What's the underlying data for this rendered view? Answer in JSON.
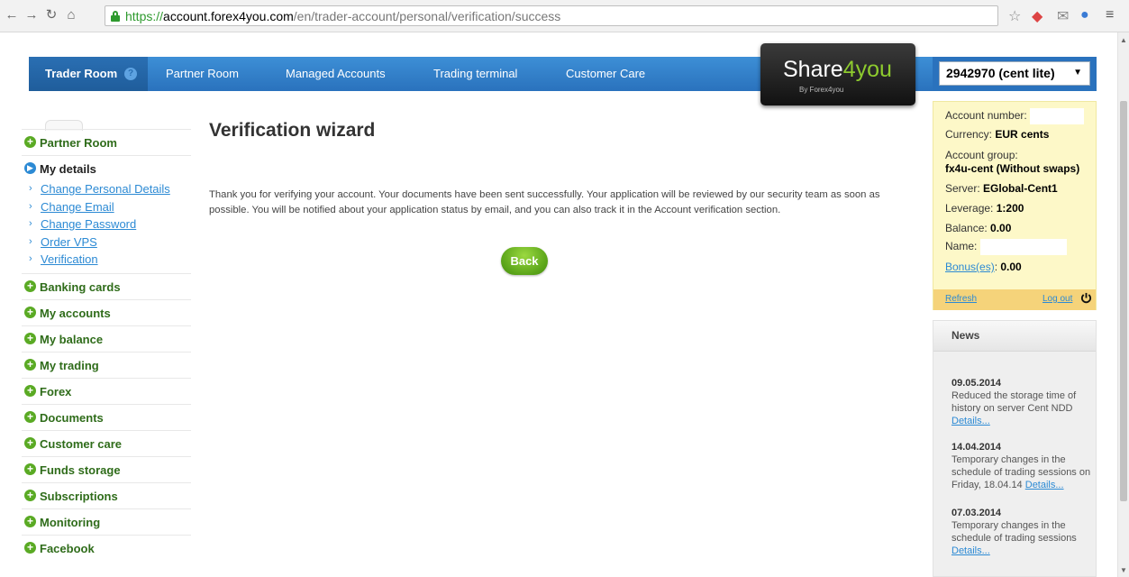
{
  "browser": {
    "url_scheme": "https://",
    "url_domain": "account.forex4you.com",
    "url_path": "/en/trader-account/personal/verification/success"
  },
  "topnav": {
    "items": [
      {
        "label": "Trader Room"
      },
      {
        "label": "Partner Room"
      },
      {
        "label": "Managed Accounts"
      },
      {
        "label": "Trading terminal"
      },
      {
        "label": "Customer Care"
      }
    ],
    "help_glyph": "?"
  },
  "logo": {
    "main_a": "Share",
    "main_b": "4you",
    "sub": "By Forex4you"
  },
  "account_select": {
    "value": "2942970 (cent lite)"
  },
  "sidebar": {
    "partner_room": "Partner Room",
    "my_details": "My details",
    "my_details_items": [
      {
        "label": "Change Personal Details"
      },
      {
        "label": "Change Email"
      },
      {
        "label": "Change Password"
      },
      {
        "label": "Order VPS"
      },
      {
        "label": "Verification"
      }
    ],
    "sections": [
      {
        "label": "Banking cards"
      },
      {
        "label": "My accounts"
      },
      {
        "label": "My balance"
      },
      {
        "label": "My trading"
      },
      {
        "label": "Forex"
      },
      {
        "label": "Documents"
      },
      {
        "label": "Customer care"
      },
      {
        "label": "Funds storage"
      },
      {
        "label": "Subscriptions"
      },
      {
        "label": "Monitoring"
      },
      {
        "label": "Facebook"
      }
    ]
  },
  "main": {
    "title": "Verification wizard",
    "message": "Thank you for verifying your account. Your documents have been sent successfully. Your application will be reviewed by our security team as soon as possible. You will be notified about your application status by email, and you can also track it in the Account verification section.",
    "back_label": "Back"
  },
  "account_panel": {
    "number_label": "Account number:",
    "currency_label": "Currency:",
    "currency_value": "EUR cents",
    "group_label": "Account group:",
    "group_value": "fx4u-cent (Without swaps)",
    "server_label": "Server:",
    "server_value": "EGlobal-Cent1",
    "leverage_label": "Leverage:",
    "leverage_value": "1:200",
    "balance_label": "Balance:",
    "balance_value": "0.00",
    "name_label": "Name:",
    "bonus_label": "Bonus(es)",
    "bonus_value": "0.00",
    "refresh_label": "Refresh",
    "logout_label": "Log out"
  },
  "news": {
    "heading": "News",
    "items": [
      {
        "date": "09.05.2014",
        "text": "Reduced the storage time of history on server Cent NDD",
        "details": "Details..."
      },
      {
        "date": "14.04.2014",
        "text": "Temporary changes in the schedule of trading sessions on Friday, 18.04.14",
        "details": "Details..."
      },
      {
        "date": "07.03.2014",
        "text": "Temporary changes in the schedule of trading sessions",
        "details": "Details..."
      }
    ]
  },
  "colors": {
    "nav_blue": "#2a72bd",
    "green": "#5aaa24",
    "link_blue": "#2c8ad4",
    "panel_yellow": "#fdf8c8"
  }
}
